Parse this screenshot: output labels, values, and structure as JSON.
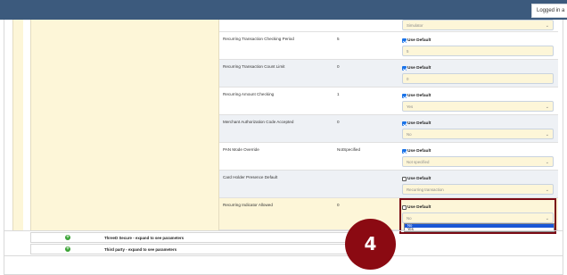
{
  "header": {
    "logged_in": "Logged in a"
  },
  "params": [
    {
      "name": "",
      "value": "",
      "use_default": true,
      "control": {
        "type": "select",
        "value": "Simulator"
      }
    },
    {
      "name": "Recurring Transaction Checking Period",
      "value": "5",
      "use_default": true,
      "control": {
        "type": "input",
        "value": "5"
      }
    },
    {
      "name": "Recurring Transaction Count Limit",
      "value": "0",
      "use_default": true,
      "control": {
        "type": "input",
        "value": "0"
      }
    },
    {
      "name": "Recurring Amount Checking",
      "value": "1",
      "use_default": true,
      "control": {
        "type": "select",
        "value": "Yes"
      }
    },
    {
      "name": "Merchant Authorization Code Accepted",
      "value": "0",
      "use_default": true,
      "control": {
        "type": "select",
        "value": "No"
      }
    },
    {
      "name": "PAN Mode Override",
      "value": "NotSpecified",
      "use_default": true,
      "control": {
        "type": "select",
        "value": "Not specified"
      }
    },
    {
      "name": "Card Holder Presence Default",
      "value": "",
      "use_default": false,
      "control": {
        "type": "select",
        "value": "Recurring transaction"
      }
    },
    {
      "name": "Recurring Indicator Allowed",
      "value": "0",
      "use_default": false,
      "control": {
        "type": "select",
        "value": "No"
      }
    }
  ],
  "checkbox_label": "Use Default",
  "dropdown_options": [
    {
      "label": "No",
      "highlighted": true
    },
    {
      "label": "Yes",
      "highlighted": false
    }
  ],
  "sections": [
    {
      "label": "ThreeD Secure - expand to see parameters"
    },
    {
      "label": "Third party - expand to see parameters"
    }
  ],
  "badge": {
    "number": "4"
  },
  "icons": {
    "expand": "plus-circle-icon",
    "chevron": "chevron-down-icon"
  },
  "colors": {
    "topbar": "#3c5a7d",
    "highlight": "#7a0a14",
    "badge": "#8b0a12",
    "accent": "#1a73e8"
  }
}
